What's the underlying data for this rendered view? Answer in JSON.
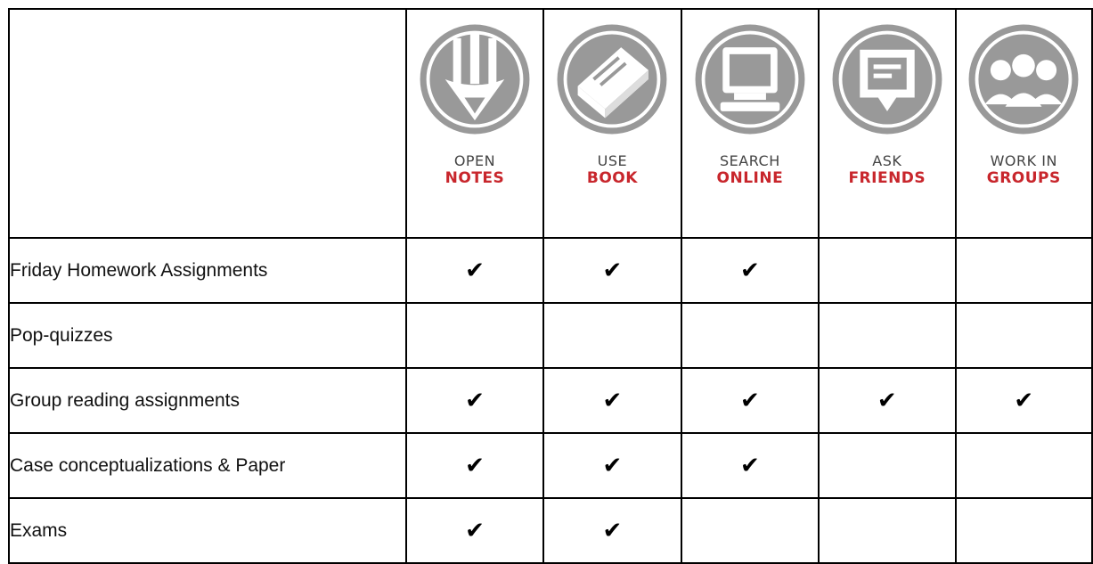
{
  "header": {
    "corner": "",
    "columns": [
      {
        "icon": "pencil-icon",
        "line1": "OPEN",
        "line2": "NOTES"
      },
      {
        "icon": "book-icon",
        "line1": "USE",
        "line2": "BOOK"
      },
      {
        "icon": "computer-icon",
        "line1": "SEARCH",
        "line2": "ONLINE"
      },
      {
        "icon": "chat-bubble-icon",
        "line1": "ASK",
        "line2": "FRIENDS"
      },
      {
        "icon": "group-icon",
        "line1": "WORK IN",
        "line2": "GROUPS"
      }
    ]
  },
  "colors": {
    "icon": "#999999",
    "accent": "#c8262c",
    "border": "#000000"
  },
  "rows": [
    {
      "label": "Friday Homework Assignments",
      "marks": [
        "✔",
        "✔",
        "✔",
        "",
        ""
      ]
    },
    {
      "label": "Pop-quizzes",
      "marks": [
        "",
        "",
        "",
        "",
        ""
      ]
    },
    {
      "label": "Group reading assignments",
      "marks": [
        "✔",
        "✔",
        "✔",
        "✔",
        "✔"
      ]
    },
    {
      "label": "Case conceptualizations & Paper",
      "marks": [
        "✔",
        "✔",
        "✔",
        "",
        ""
      ]
    },
    {
      "label": "Exams",
      "marks": [
        "✔",
        "✔",
        "",
        "",
        ""
      ]
    }
  ]
}
